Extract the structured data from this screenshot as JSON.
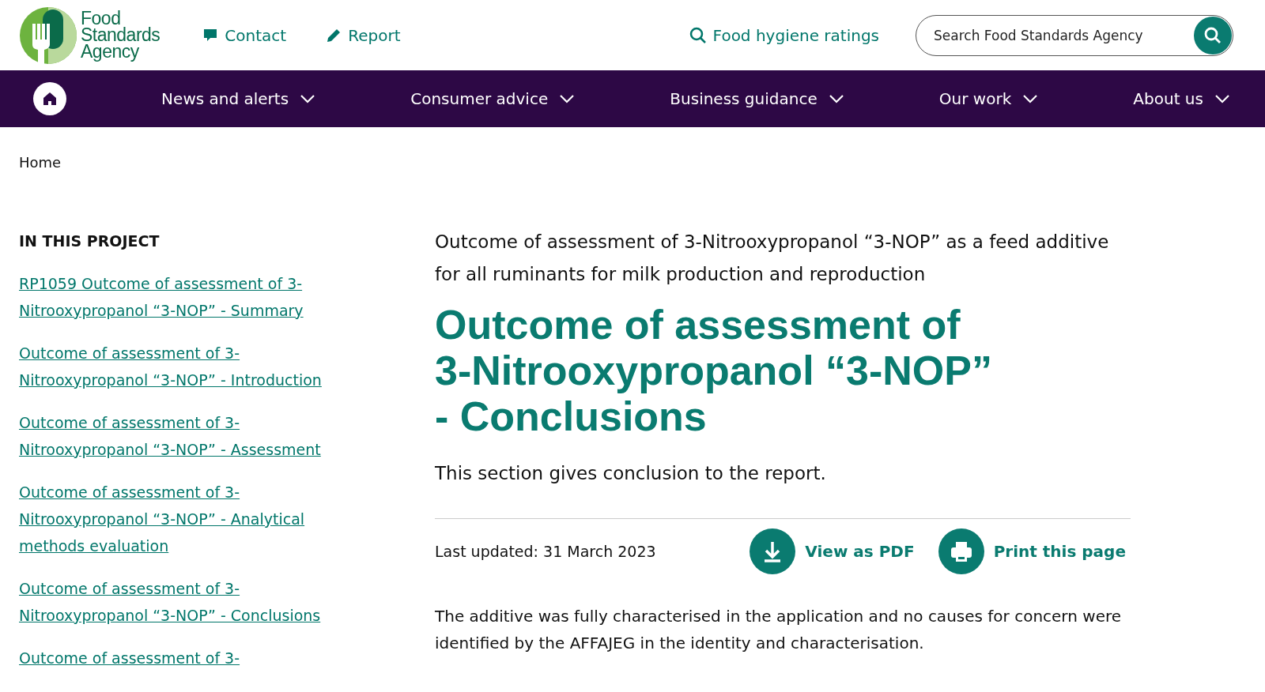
{
  "header": {
    "logo_text": [
      "Food",
      "Standards",
      "Agency"
    ],
    "links": [
      {
        "kind": "contact",
        "label": "Contact"
      },
      {
        "kind": "report",
        "label": "Report"
      }
    ],
    "ratings_link": "Food hygiene ratings",
    "search": {
      "placeholder": "Search Food Standards Agency"
    }
  },
  "nav": {
    "items": [
      {
        "label": "News and alerts"
      },
      {
        "label": "Consumer advice"
      },
      {
        "label": "Business guidance"
      },
      {
        "label": "Our work"
      },
      {
        "label": "About us"
      }
    ]
  },
  "breadcrumb": [
    "Home"
  ],
  "sidebar": {
    "heading": "IN THIS PROJECT",
    "links": [
      "RP1059 Outcome of assessment of 3-Nitrooxypropanol “3-NOP” - Summary",
      "Outcome of assessment of 3-Nitrooxypropanol “3-NOP” - Introduction",
      "Outcome of assessment of 3-Nitrooxypropanol “3-NOP” - Assessment",
      "Outcome of assessment of 3-Nitrooxypropanol “3-NOP” - Analytical methods evaluation",
      "Outcome of assessment of 3-Nitrooxypropanol “3-NOP” - Conclusions",
      "Outcome of assessment of 3-"
    ]
  },
  "main": {
    "parent_title": "Outcome of assessment of 3-Nitrooxypropanol “3-NOP” as a feed additive for all ruminants for milk production and reproduction",
    "title": "Outcome of assessment of 3-Nitrooxypropanol “3-NOP” - Conclusions",
    "summary": "This section gives conclusion to the report.",
    "last_updated": "Last updated: 31 March 2023",
    "actions": [
      {
        "kind": "download",
        "label": "View as PDF"
      },
      {
        "kind": "print",
        "label": "Print this page"
      }
    ],
    "body": "The additive was fully characterised in the application and no causes for concern were identified by the AFFAJEG in the identity and characterisation."
  }
}
